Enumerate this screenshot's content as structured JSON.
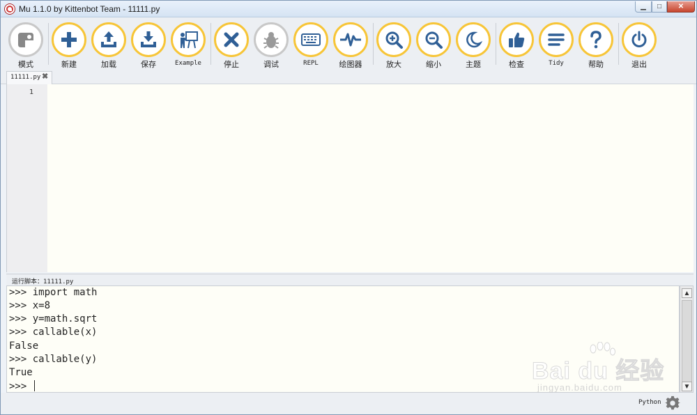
{
  "window": {
    "title": "Mu 1.1.0 by Kittenbot Team - 11111.py",
    "controls": {
      "minimize": "▁",
      "maximize": "□",
      "close": "✕"
    }
  },
  "toolbar": {
    "accent_color": "#f7c537",
    "icon_color": "#2f5f96",
    "buttons": [
      {
        "id": "mode",
        "label": "模式",
        "icon": "mu-logo-icon"
      },
      {
        "id": "new",
        "label": "新建",
        "icon": "plus-icon"
      },
      {
        "id": "load",
        "label": "加载",
        "icon": "upload-icon"
      },
      {
        "id": "save",
        "label": "保存",
        "icon": "download-icon"
      },
      {
        "id": "example",
        "label": "Example",
        "icon": "teacher-board-icon"
      },
      {
        "id": "stop",
        "label": "停止",
        "icon": "close-x-icon"
      },
      {
        "id": "debug",
        "label": "调试",
        "icon": "bug-icon"
      },
      {
        "id": "repl",
        "label": "REPL",
        "icon": "keyboard-icon"
      },
      {
        "id": "plotter",
        "label": "绘图器",
        "icon": "pulse-wave-icon"
      },
      {
        "id": "zoom-in",
        "label": "放大",
        "icon": "zoom-in-icon"
      },
      {
        "id": "zoom-out",
        "label": "缩小",
        "icon": "zoom-out-icon"
      },
      {
        "id": "theme",
        "label": "主题",
        "icon": "moon-icon"
      },
      {
        "id": "check",
        "label": "检查",
        "icon": "thumbs-up-icon"
      },
      {
        "id": "tidy",
        "label": "Tidy",
        "icon": "lines-icon"
      },
      {
        "id": "help",
        "label": "帮助",
        "icon": "question-icon"
      },
      {
        "id": "quit",
        "label": "退出",
        "icon": "power-icon"
      }
    ]
  },
  "tabs": [
    {
      "label": "11111.py",
      "close": "✖"
    }
  ],
  "editor": {
    "line_numbers": [
      "1"
    ]
  },
  "repl": {
    "caption": "运行脚本：11111.py",
    "lines": [
      ">>> import math",
      ">>> x=8",
      ">>> y=math.sqrt",
      ">>> callable(x)",
      "False",
      ">>> callable(y)",
      "True"
    ],
    "prompt": ">>> "
  },
  "statusbar": {
    "mode": "Python"
  },
  "watermark": {
    "main": "Bai du 经验",
    "sub": "jingyan.baidu.com"
  }
}
